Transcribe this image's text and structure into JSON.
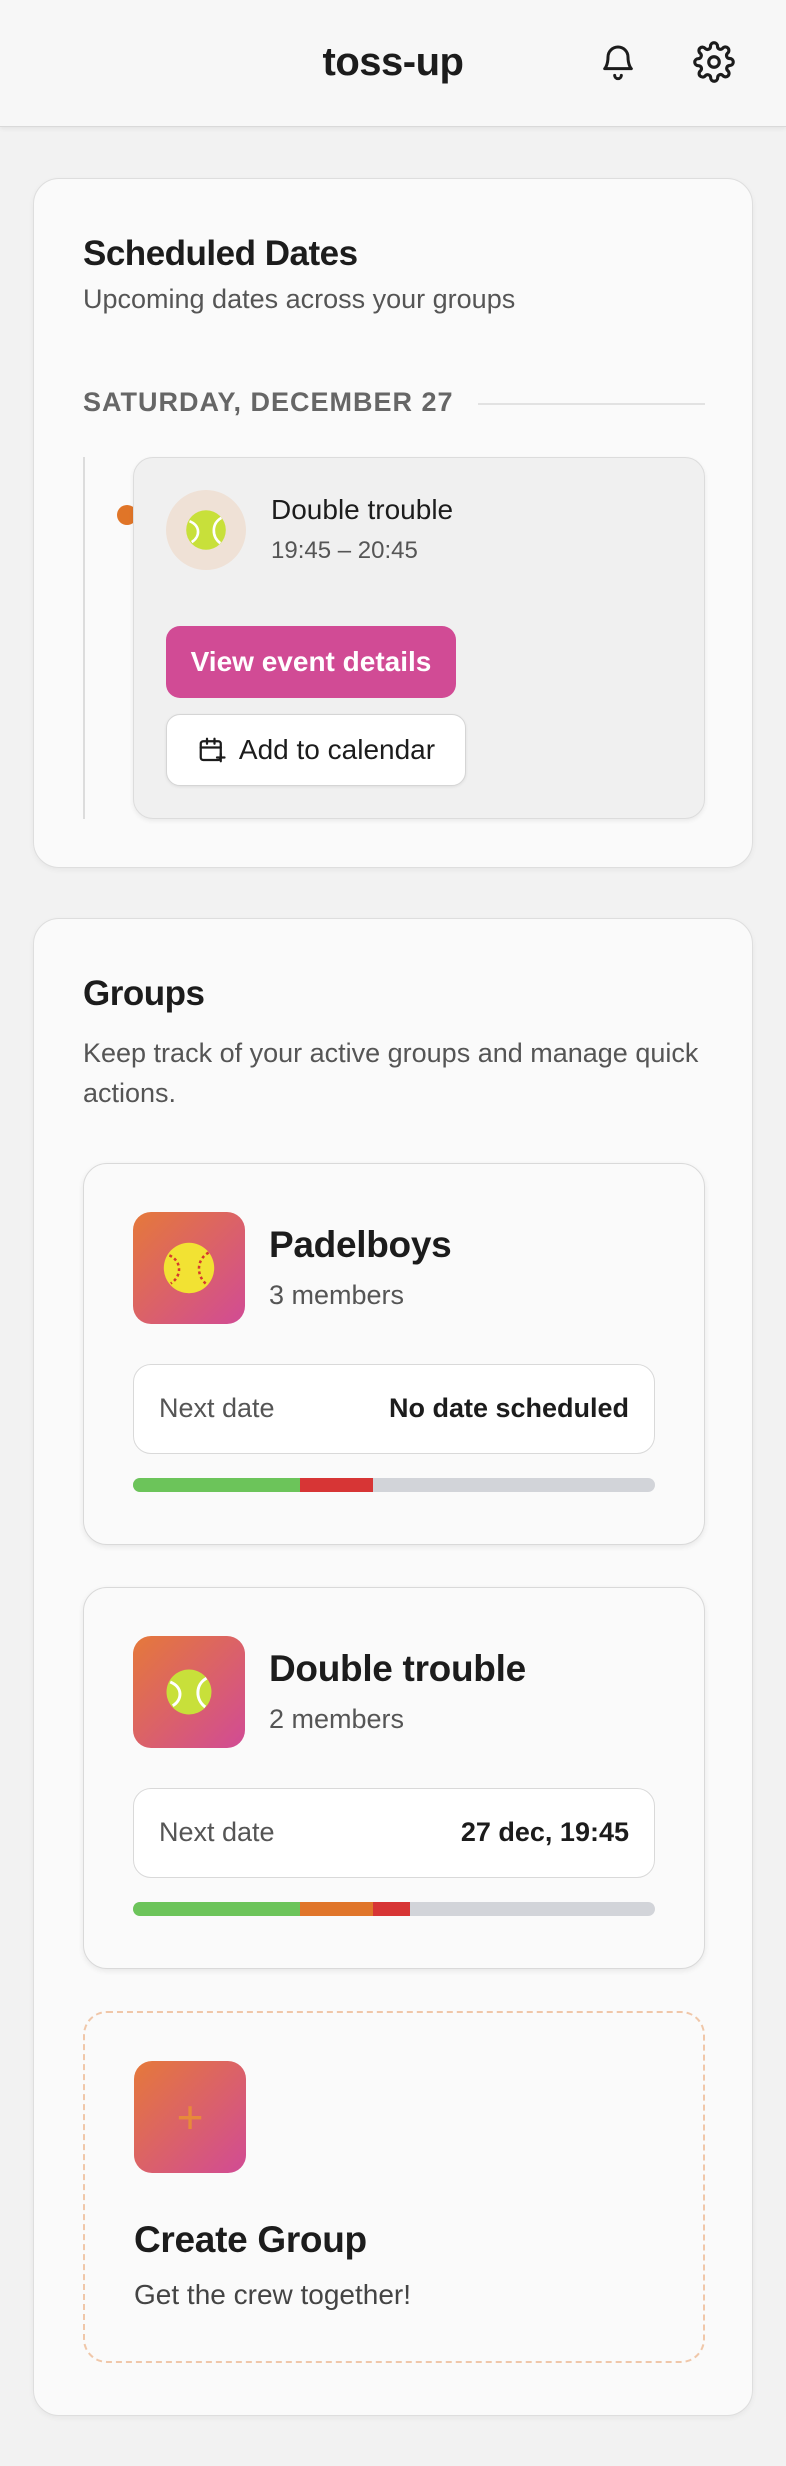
{
  "header": {
    "title": "toss-up",
    "icons": {
      "notifications": "bell-icon",
      "settings": "gear-icon"
    }
  },
  "scheduled": {
    "title": "Scheduled Dates",
    "subtitle": "Upcoming dates across your groups",
    "day_label": "SATURDAY, DECEMBER 27",
    "event": {
      "name": "Double trouble",
      "time": "19:45 – 20:45",
      "avatar_icon": "tennis-ball-icon",
      "view_label": "View event details",
      "calendar_label": "Add to calendar",
      "calendar_icon": "calendar-plus-icon"
    }
  },
  "groups": {
    "title": "Groups",
    "subtitle": "Keep track of your active groups and manage quick actions.",
    "items": [
      {
        "name": "Padelboys",
        "members": "3 members",
        "icon": "softball-icon",
        "next_label": "Next date",
        "next_value": "No date scheduled",
        "bar": [
          {
            "color": "#6cc45a",
            "fraction": 0.32
          },
          {
            "color": "#d73535",
            "fraction": 0.14
          }
        ]
      },
      {
        "name": "Double trouble",
        "members": "2 members",
        "icon": "tennis-ball-icon",
        "next_label": "Next date",
        "next_value": "27 dec, 19:45",
        "bar": [
          {
            "color": "#6cc45a",
            "fraction": 0.32
          },
          {
            "color": "#e0752a",
            "fraction": 0.14
          },
          {
            "color": "#d73535",
            "fraction": 0.07
          }
        ]
      }
    ],
    "create": {
      "title": "Create Group",
      "subtitle": "Get the crew together!",
      "icon": "plus-icon",
      "plus": "+"
    }
  },
  "colors": {
    "accent_pink": "#d14b95",
    "accent_orange": "#e07528",
    "bar_empty": "#d2d4d9"
  }
}
